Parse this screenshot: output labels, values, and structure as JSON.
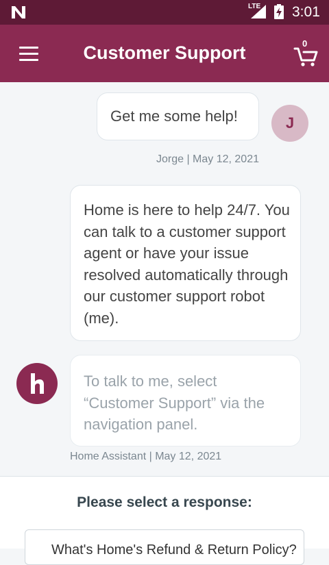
{
  "status_bar": {
    "network": "LTE",
    "time": "3:01"
  },
  "app_bar": {
    "title": "Customer Support",
    "cart_count": "0"
  },
  "messages": [
    {
      "sender": "user",
      "text": "Get me some help!",
      "avatar_initial": "J",
      "meta": "Jorge | May 12, 2021"
    },
    {
      "sender": "bot",
      "text": "Home is here to help 24/7. You can talk to a customer support agent or have your issue resolved automatically through our customer support robot (me)."
    },
    {
      "sender": "bot",
      "text": "To talk to me, select “Customer Support” via the navigation panel.",
      "meta": "Home Assistant | May 12, 2021"
    }
  ],
  "response_panel": {
    "title": "Please select a response:",
    "options": [
      "What's Home's Refund & Return Policy?"
    ]
  },
  "colors": {
    "primary": "#8b2a52",
    "status_bar": "#5e1a36",
    "background": "#f4f6f8"
  },
  "icons": {
    "menu": "hamburger-icon",
    "cart": "cart-icon",
    "bot_avatar": "home-logo-icon"
  }
}
